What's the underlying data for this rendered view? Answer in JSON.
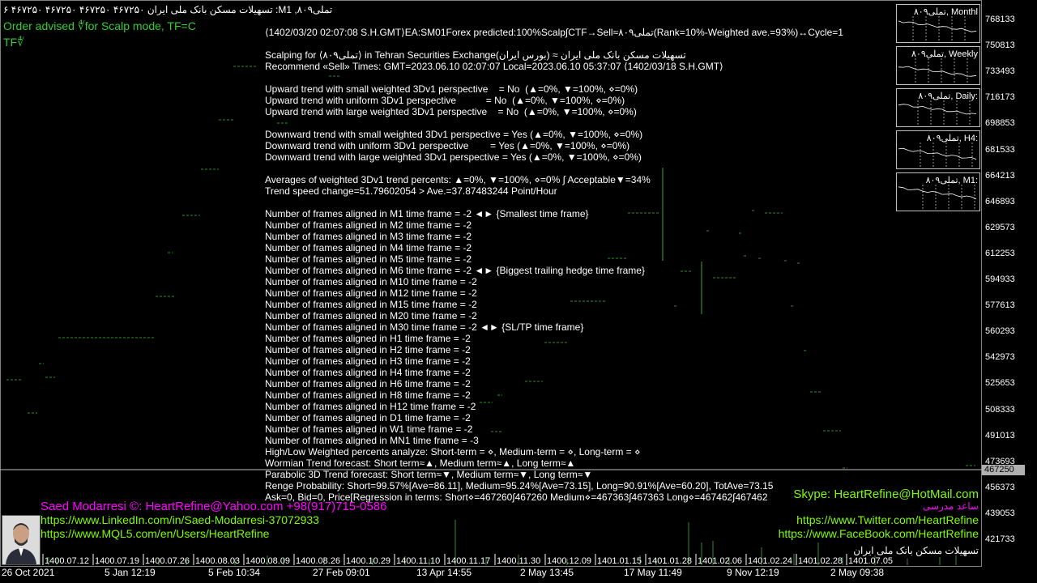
{
  "header": {
    "title": "تسهیلات مسکن بانک ملی ایران  ۴۶۷۲۵۰ ۴۶۷۲۵۰ ۴۶۷۲۵۰ ۴۶۷۲۵۰ ۶ :M1 ,تملی۸۰۹",
    "order_advised_1": "Order advised ∜for Scalp mode, TF=C",
    "order_advised_2": "TF∜"
  },
  "info_lines": [
    "⟨1402/03/20 02:07:08 S.H.GMT⟩EA:SM01Forex predicted:100%Scalp∫CTF→Sell≈تملی۸۰۹(Rank=10%-Weighted ave.=93%)↔Cycle=1",
    "",
    "Scalping for ⟨تملی۸۰۹⟩ in Tehran Securities Exchange(بورس ایران) ≈ تسهیلات مسکن بانک ملی ایران",
    "Recommend «Sell» Times: GMT=2023.06.10 02:07:07 Local=2023.06.10 05:37:07 ⟨1402/03/18 S.H.GMT⟩",
    "",
    "Upward trend with small weighted 3Dv1 perspective    = No  (▲=0%, ▼=100%, ⋄=0%)",
    "Upward trend with uniform 3Dv1 perspective           = No  (▲=0%, ▼=100%, ⋄=0%)",
    "Upward trend with large weighted 3Dv1 perspective    = No  (▲=0%, ▼=100%, ⋄=0%)",
    "",
    "Downward trend with small weighted 3Dv1 perspective = Yes (▲=0%, ▼=100%, ⋄=0%)",
    "Downward trend with uniform 3Dv1 perspective        = Yes (▲=0%, ▼=100%, ⋄=0%)",
    "Downward trend with large weighted 3Dv1 perspective = Yes (▲=0%, ▼=100%, ⋄=0%)",
    "",
    "Averages of weighted 3Dv1 trend percents: ▲=0%, ▼=100%, ⋄=0% ∫ Acceptable▼=34%",
    "Trend speed change=51.79602054 > Ave.=37.87483244 Point/Hour",
    "",
    "Number of frames aligned in M1 time frame = -2 ◄► {Smallest time frame}",
    "Number of frames aligned in M2 time frame = -2",
    "Number of frames aligned in M3 time frame = -2",
    "Number of frames aligned in M4 time frame = -2",
    "Number of frames aligned in M5 time frame = -2",
    "Number of frames aligned in M6 time frame = -2 ◄► {Biggest trailing hedge time frame}",
    "Number of frames aligned in M10 time frame = -2",
    "Number of frames aligned in M12 time frame = -2",
    "Number of frames aligned in M15 time frame = -2",
    "Number of frames aligned in M20 time frame = -2",
    "Number of frames aligned in M30 time frame = -2 ◄► {SL/TP time frame}",
    "Number of frames aligned in H1 time frame = -2",
    "Number of frames aligned in H2 time frame = -2",
    "Number of frames aligned in H3 time frame = -2",
    "Number of frames aligned in H4 time frame = -2",
    "Number of frames aligned in H6 time frame = -2",
    "Number of frames aligned in H8 time frame = -2",
    "Number of frames aligned in H12 time frame = -2",
    "Number of frames aligned in D1 time frame = -2",
    "Number of frames aligned in W1 time frame = -2",
    "Number of frames aligned in MN1 time frame = -3",
    "High/Low Weighted percents analyze: Short-term = ⋄, Medium-term = ⋄, Long-term = ⋄",
    "Wormian Trend forecast: Short term≈▲, Medium term≈▲, Long term≈▲",
    "Parabolic 3D Trend forecast: Short term≈▼, Medium term≈▼, Long term≈▼",
    "Renge Probability: Short=99.57%[Ave=86.11], Medium=95.24%[Ave=73.15], Long=90.91%[Ave=60.20], TotAve=73.15",
    "Ask=0, Bid=0, Price[Regression in terms: Short⋄=467260∫467260 Medium⋄=467363∫467363 Long⋄=467462∫467462"
  ],
  "price_axis": {
    "ticks": [
      "768133",
      "750813",
      "733493",
      "716173",
      "698853",
      "681533",
      "664213",
      "646893",
      "629573",
      "612253",
      "594933",
      "577613",
      "560293",
      "542973",
      "525653",
      "508333",
      "491013",
      "473693",
      "456373",
      "439053",
      "421733"
    ],
    "current_price": "467250"
  },
  "time_axis": {
    "ticks": [
      "26 Oct 2021",
      "5 Jan 12:19",
      "5 Feb 10:34",
      "27 Feb 09:01",
      "13 Apr 14:55",
      "2 May 13:45",
      "17 May 11:49",
      "9 Nov 12:19",
      "2 May 09:38"
    ],
    "date_labels": [
      "1400.07.12",
      "1400.07.19",
      "1400.07.26",
      "1400.08.03",
      "1400.08.09",
      "1400.08.26",
      "1400.10.29",
      "1400.11.10",
      "1400.11.17",
      "1400.11.30",
      "1400.12.09",
      "1401.01.15",
      "1401.01.28",
      "1401.02.06",
      "1401.02.24",
      "1401.02.28",
      "1401.07.05"
    ]
  },
  "tf_panels": [
    {
      "label": "تملی۸۰۹, Monthl"
    },
    {
      "label": "تملی۸۰۹, Weekly"
    },
    {
      "label": "تملی۸۰۹, Daily:"
    },
    {
      "label": "تملی۸۰۹, H4:"
    },
    {
      "label": "تملی۸۰۹, M1:"
    }
  ],
  "contacts": {
    "name_email": "Saed Modarresi ©: HeartRefine@Yahoo.com +98(917)715-0586",
    "linkedin": "https://www.LinkedIn.com/in/Saed-Modarresi-37072933",
    "mql5": "https://www.MQL5.com/en/Users/HeartRefine",
    "skype": "Skype: HeartRefine@HotMail.com",
    "name_fa": "ساعد مدرسی",
    "twitter": "https://www.Twitter.com/HeartRefine",
    "facebook": "https://www.FaceBook.com/HeartRefine",
    "symbol_watermark": "تسهیلات مسکن بانک ملی ایران"
  },
  "colors": {
    "background": "#000000",
    "green_text": "#32cd32",
    "link_green": "#7cfc00",
    "magenta": "#ff00ff",
    "chart_green": "#228b22"
  }
}
